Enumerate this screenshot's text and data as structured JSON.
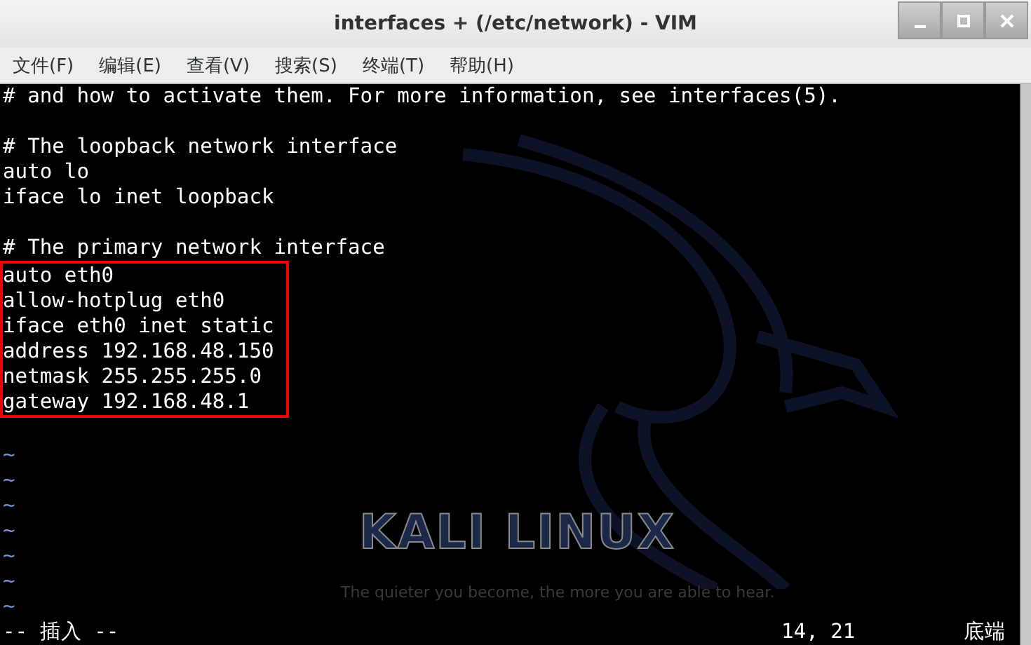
{
  "window": {
    "title": "interfaces + (/etc/network) - VIM"
  },
  "menu": [
    {
      "label": "文件(F)"
    },
    {
      "label": "编辑(E)"
    },
    {
      "label": "查看(V)"
    },
    {
      "label": "搜索(S)"
    },
    {
      "label": "终端(T)"
    },
    {
      "label": "帮助(H)"
    }
  ],
  "wallpaper": {
    "logo_text": "KALI LINUX",
    "tagline": "The quieter you become, the more you are able to hear."
  },
  "lines": [
    {
      "text": "# and how to activate them. For more information, see interfaces(5).",
      "boxed": false
    },
    {
      "boxed": false
    },
    {
      "text": "# The loopback network interface",
      "boxed": false
    },
    {
      "text": "auto lo",
      "boxed": false
    },
    {
      "text": "iface lo inet loopback",
      "boxed": false
    },
    {
      "boxed": false
    },
    {
      "text": "# The primary network interface",
      "boxed": false
    },
    {
      "text": "auto eth0",
      "boxed": true
    },
    {
      "text": "allow-hotplug eth0",
      "boxed": true
    },
    {
      "text": "iface eth0 inet static",
      "boxed": true
    },
    {
      "text": "address 192.168.48.150",
      "boxed": true
    },
    {
      "text": "netmask 255.255.255.0",
      "boxed": true
    },
    {
      "text": "gateway 192.168.48.1",
      "boxed": true
    },
    {
      "boxed": false
    }
  ],
  "filler": [
    "~",
    "~",
    "~",
    "~",
    "~",
    "~",
    "~"
  ],
  "status": {
    "mode": "-- 插入 --",
    "position": "14, 21",
    "scroll": "底端"
  }
}
